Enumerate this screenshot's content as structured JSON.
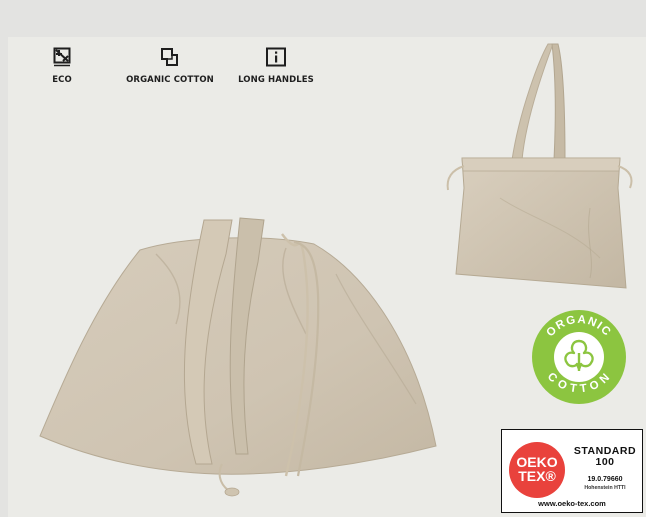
{
  "features": [
    {
      "icon": "eco-leaf-box-icon",
      "label": "ECO"
    },
    {
      "icon": "organic-cotton-icon",
      "label": "ORGANIC COTTON"
    },
    {
      "icon": "info-icon",
      "label": "LONG HANDLES"
    }
  ],
  "colors": {
    "page_bg": "#e3e3e1",
    "panel_bg": "#ebebe7",
    "bag_fabric": "#cfc4b2",
    "organic_green": "#8cc540",
    "oeko_red": "#e9423c"
  },
  "organic_badge": {
    "top_text": "ORGANIC",
    "bottom_text": "COTTON"
  },
  "oeko_label": {
    "brand_line1": "OEKO",
    "brand_line2": "TEX®",
    "standard_line1": "STANDARD",
    "standard_line2": "100",
    "certificate": "19.0.79660",
    "institute": "Hohenstein HTTI",
    "url": "www.oeko-tex.com"
  }
}
